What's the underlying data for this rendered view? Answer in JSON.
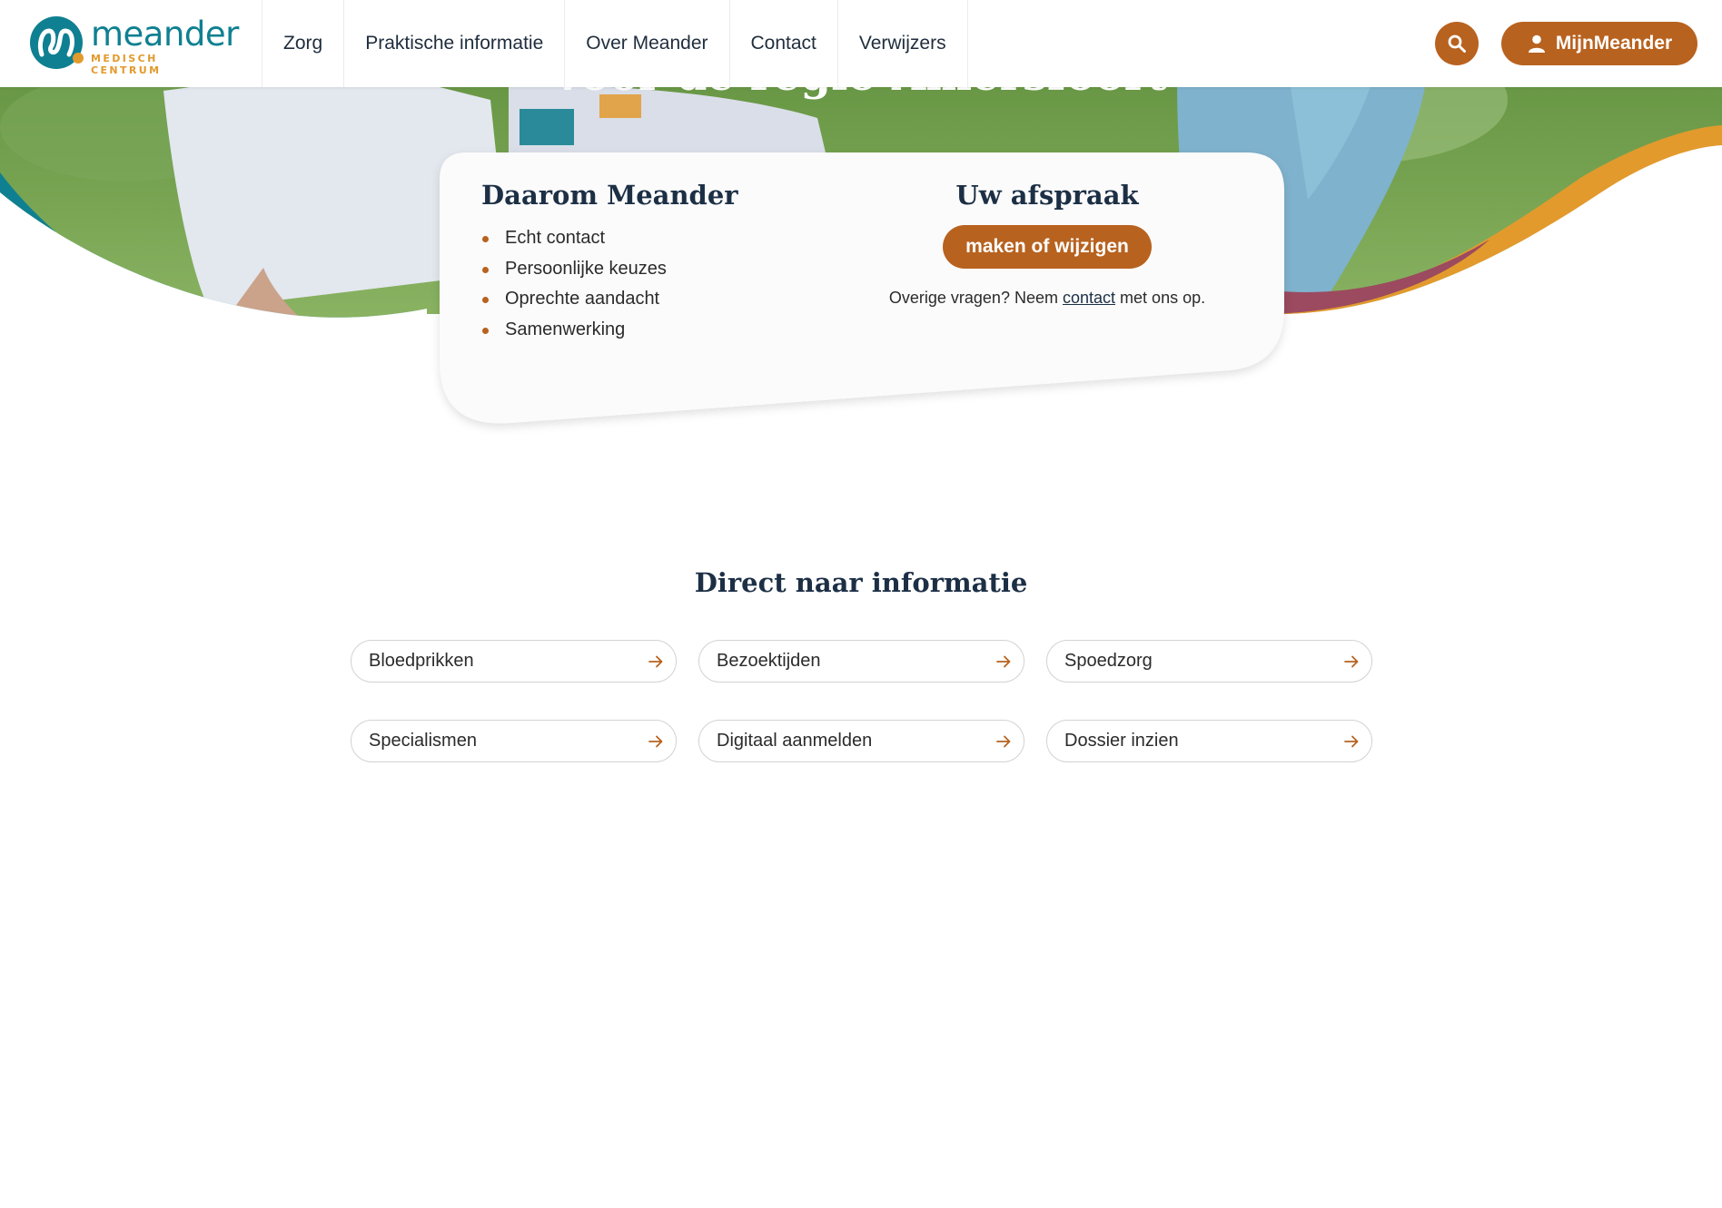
{
  "brand": {
    "name": "meander",
    "tagline": "MEDISCH CENTRUM",
    "colors": {
      "teal": "#0f8091",
      "orange_brand": "#b8621f",
      "gold": "#e29a2d",
      "plum": "#9b4a5f",
      "navy_text": "#1c2f45"
    }
  },
  "nav": {
    "items": [
      {
        "label": "Zorg"
      },
      {
        "label": "Praktische informatie"
      },
      {
        "label": "Over Meander"
      },
      {
        "label": "Contact"
      },
      {
        "label": "Verwijzers"
      }
    ],
    "search_icon": "search-icon",
    "account": {
      "label": "MijnMeander",
      "icon": "user-icon"
    }
  },
  "hero": {
    "title": "voor de regio Amersfoort"
  },
  "card": {
    "reasons_title": "Daarom Meander",
    "reasons": [
      "Echt contact",
      "Persoonlijke keuzes",
      "Oprechte aandacht",
      "Samenwerking"
    ],
    "appointment": {
      "title": "Uw afspraak",
      "button_label": "maken of wijzigen",
      "note_before": "Overige vragen? Neem",
      "note_link": "contact",
      "note_after": "met ons op."
    }
  },
  "direct_info": {
    "title": "Direct naar informatie",
    "links": [
      {
        "label": "Bloedprikken"
      },
      {
        "label": "Bezoektijden"
      },
      {
        "label": "Spoedzorg"
      },
      {
        "label": "Specialismen"
      },
      {
        "label": "Digitaal aanmelden"
      },
      {
        "label": "Dossier inzien"
      }
    ],
    "arrow_icon": "arrow-right-icon"
  }
}
